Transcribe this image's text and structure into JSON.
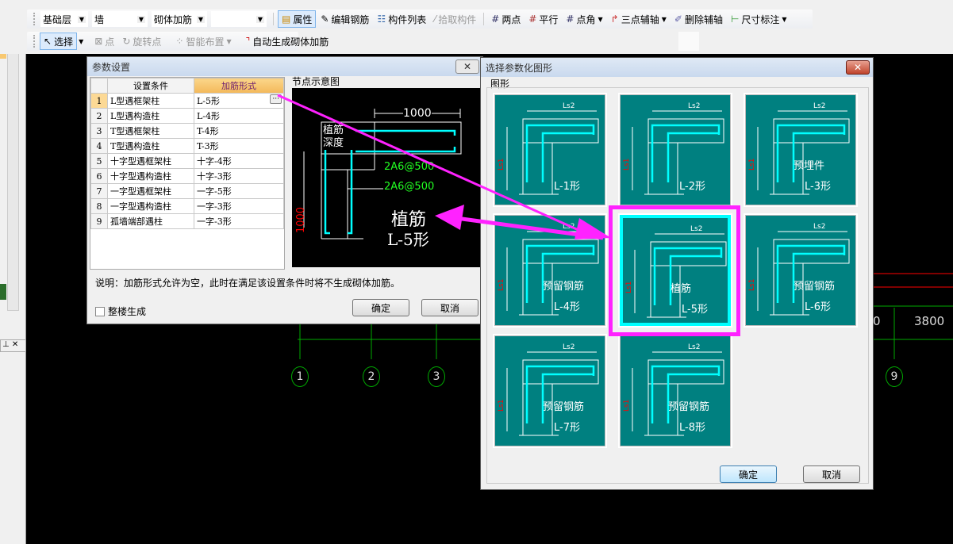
{
  "toolbar": {
    "row2": {
      "floor": "基础层",
      "type": "墙",
      "component": "砌体加筋",
      "blank": "",
      "buttons": [
        "属性",
        "编辑钢筋",
        "构件列表",
        "拾取构件",
        "两点",
        "平行",
        "点角",
        "三点辅轴",
        "删除辅轴",
        "尺寸标注"
      ]
    },
    "row3": {
      "buttons": [
        "选择",
        "点",
        "旋转点",
        "智能布置",
        "自动生成砌体加筋"
      ]
    }
  },
  "param_dialog": {
    "title": "参数设置",
    "columns": [
      "设置条件",
      "加筋形式"
    ],
    "rows": [
      {
        "n": "1",
        "cond": "L型遇框架柱",
        "form": "L-5形"
      },
      {
        "n": "2",
        "cond": "L型遇构造柱",
        "form": "L-4形"
      },
      {
        "n": "3",
        "cond": "T型遇框架柱",
        "form": "T-4形"
      },
      {
        "n": "4",
        "cond": "T型遇构造柱",
        "form": "T-3形"
      },
      {
        "n": "5",
        "cond": "十字型遇框架柱",
        "form": "十字-4形"
      },
      {
        "n": "6",
        "cond": "十字型遇构造柱",
        "form": "十字-3形"
      },
      {
        "n": "7",
        "cond": "一字型遇框架柱",
        "form": "一字-5形"
      },
      {
        "n": "8",
        "cond": "一字型遇构造柱",
        "form": "一字-3形"
      },
      {
        "n": "9",
        "cond": "孤墙端部遇柱",
        "form": "一字-3形"
      }
    ],
    "ellipsis": "···",
    "preview_label": "节点示意图",
    "preview": {
      "dim_top": "1000",
      "dim_left": "1000",
      "depth1": "植筋",
      "depth2": "深度",
      "rebar1": "2A6@500",
      "rebar2": "2A6@500",
      "name1": "植筋",
      "name2": "L-5形"
    },
    "note": "说明：加筋形式允许为空，此时在满足该设置条件时将不生成砌体加筋。",
    "checkbox_label": "整楼生成",
    "checkbox_checked": false,
    "ok": "确定",
    "cancel": "取消"
  },
  "shape_dialog": {
    "title": "选择参数化图形",
    "group": "图形",
    "selected": "L-5形",
    "tiles": [
      {
        "t1": "",
        "t2": "L-1形"
      },
      {
        "t1": "",
        "t2": "L-2形"
      },
      {
        "t1": "预埋件",
        "t2": "L-3形"
      },
      {
        "t1": "预留钢筋",
        "t2": "L-4形"
      },
      {
        "t1": "植筋",
        "t2": "L-5形"
      },
      {
        "t1": "预留钢筋",
        "t2": "L-6形"
      },
      {
        "t1": "预留钢筋",
        "t2": "L-7形"
      },
      {
        "t1": "预留钢筋",
        "t2": "L-8形"
      }
    ],
    "ok": "确定",
    "cancel": "取消"
  },
  "canvas": {
    "axes": [
      "1",
      "2",
      "3",
      "9"
    ],
    "dims": [
      "3800",
      "0"
    ]
  },
  "colors": {
    "tile": "#008080",
    "rebar": "#00ffff",
    "highlight": "#ff22ff",
    "grid": "#00aa00",
    "dim_red": "#ff0000"
  }
}
